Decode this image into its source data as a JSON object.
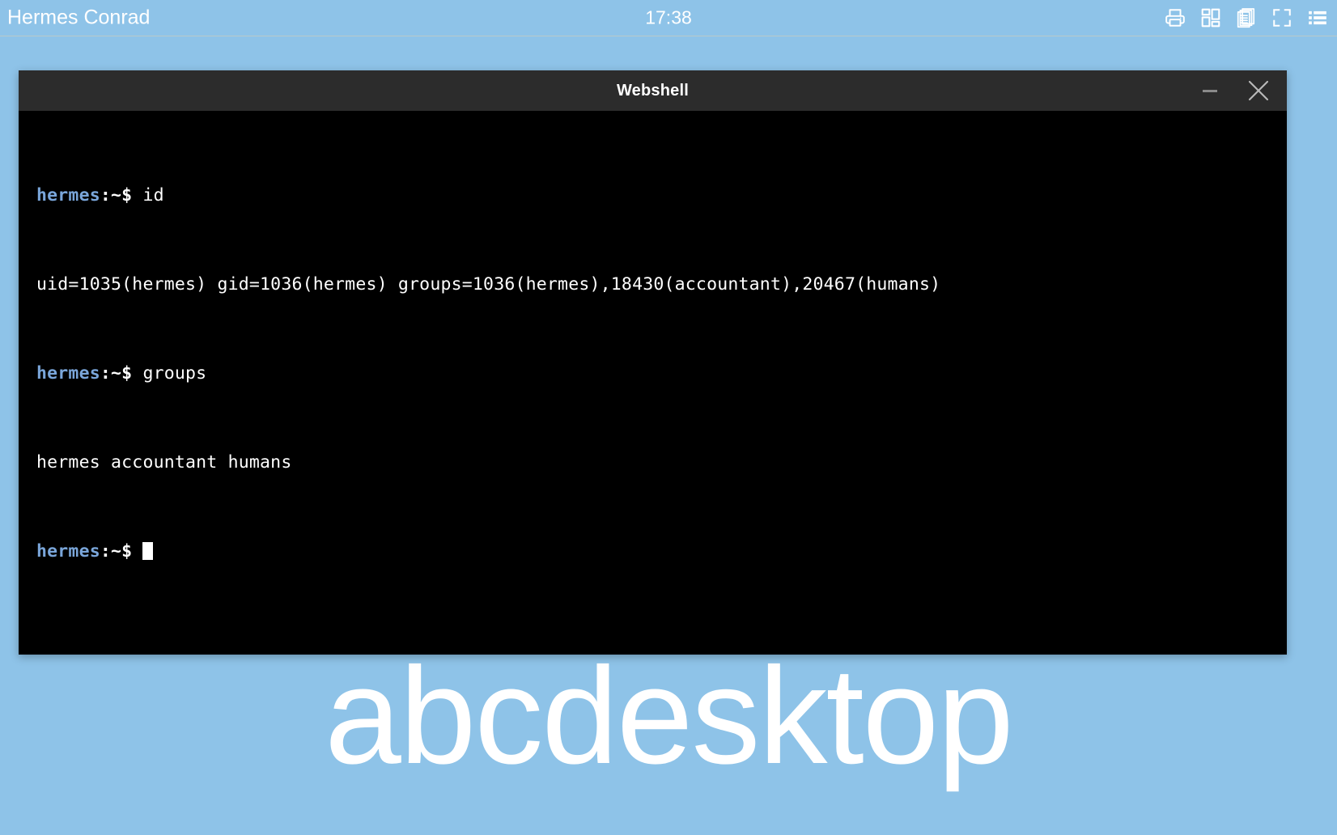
{
  "topbar": {
    "user_name": "Hermes Conrad",
    "clock": "17:38",
    "background_color": "#8ec3e8",
    "text_color": "#ffffff",
    "tray_icons": [
      {
        "name": "printer-icon",
        "label": "Print"
      },
      {
        "name": "app-grid-icon",
        "label": "Applications"
      },
      {
        "name": "documents-icon",
        "label": "Documents"
      },
      {
        "name": "fullscreen-icon",
        "label": "Fullscreen"
      },
      {
        "name": "list-menu-icon",
        "label": "Menu"
      }
    ]
  },
  "desktop": {
    "wordmark": "abcdesktop",
    "wordmark_color": "#ffffff",
    "background_color": "#8ec3e8"
  },
  "window": {
    "title": "Webshell",
    "titlebar_color": "#2c2c2c",
    "minimize_label": "Minimize",
    "close_label": "Close",
    "terminal": {
      "background_color": "#000000",
      "foreground_color": "#ffffff",
      "prompt_user_color": "#7aa6da",
      "prompt_user": "hermes",
      "prompt_sigil": ":~$",
      "lines": [
        {
          "type": "prompt",
          "user": "hermes",
          "sigil": ":~$",
          "command": " id"
        },
        {
          "type": "output",
          "text": "uid=1035(hermes) gid=1036(hermes) groups=1036(hermes),18430(accountant),20467(humans)"
        },
        {
          "type": "prompt",
          "user": "hermes",
          "sigil": ":~$",
          "command": " groups"
        },
        {
          "type": "output",
          "text": "hermes accountant humans"
        },
        {
          "type": "prompt",
          "user": "hermes",
          "sigil": ":~$",
          "command": " ",
          "cursor": true
        }
      ]
    }
  }
}
